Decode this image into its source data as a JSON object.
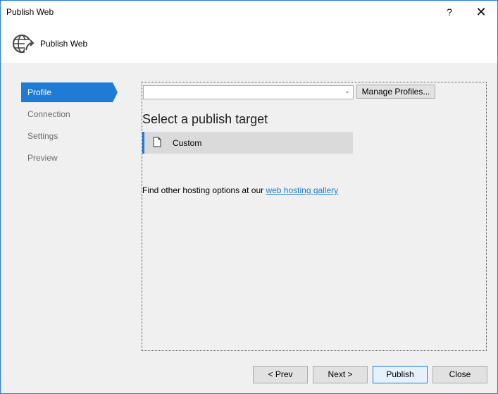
{
  "window": {
    "title": "Publish Web",
    "help_label": "?",
    "close_label": "✕"
  },
  "header": {
    "title": "Publish Web",
    "icon": "globe-publish-icon"
  },
  "nav": {
    "items": [
      {
        "label": "Profile",
        "active": true
      },
      {
        "label": "Connection",
        "active": false
      },
      {
        "label": "Settings",
        "active": false
      },
      {
        "label": "Preview",
        "active": false
      }
    ]
  },
  "profile": {
    "selected_value": "",
    "manage_label": "Manage Profiles..."
  },
  "target": {
    "heading": "Select a publish target",
    "items": [
      {
        "label": "Custom",
        "icon": "document-icon"
      }
    ]
  },
  "hosting": {
    "text": "Find other hosting options at our ",
    "link_label": "web hosting gallery"
  },
  "footer": {
    "prev_label": "< Prev",
    "next_label": "Next >",
    "publish_label": "Publish",
    "close_label": "Close"
  },
  "colors": {
    "accent": "#1e7bd6",
    "window_border": "#2b79d8",
    "body_bg": "#f0f0f0"
  }
}
